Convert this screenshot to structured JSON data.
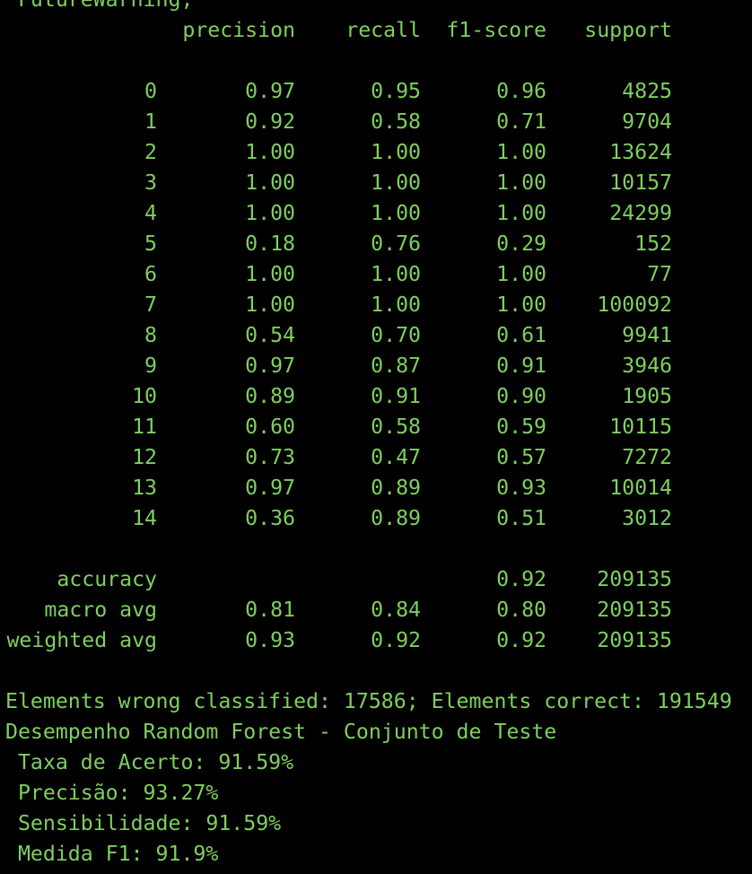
{
  "terminal": {
    "top_line": " FutureWarning,",
    "header": {
      "precision": "precision",
      "recall": "recall",
      "f1": "f1-score",
      "support": "support"
    },
    "rows": [
      {
        "label": "0",
        "precision": "0.97",
        "recall": "0.95",
        "f1": "0.96",
        "support": "4825"
      },
      {
        "label": "1",
        "precision": "0.92",
        "recall": "0.58",
        "f1": "0.71",
        "support": "9704"
      },
      {
        "label": "2",
        "precision": "1.00",
        "recall": "1.00",
        "f1": "1.00",
        "support": "13624"
      },
      {
        "label": "3",
        "precision": "1.00",
        "recall": "1.00",
        "f1": "1.00",
        "support": "10157"
      },
      {
        "label": "4",
        "precision": "1.00",
        "recall": "1.00",
        "f1": "1.00",
        "support": "24299"
      },
      {
        "label": "5",
        "precision": "0.18",
        "recall": "0.76",
        "f1": "0.29",
        "support": "152"
      },
      {
        "label": "6",
        "precision": "1.00",
        "recall": "1.00",
        "f1": "1.00",
        "support": "77"
      },
      {
        "label": "7",
        "precision": "1.00",
        "recall": "1.00",
        "f1": "1.00",
        "support": "100092"
      },
      {
        "label": "8",
        "precision": "0.54",
        "recall": "0.70",
        "f1": "0.61",
        "support": "9941"
      },
      {
        "label": "9",
        "precision": "0.97",
        "recall": "0.87",
        "f1": "0.91",
        "support": "3946"
      },
      {
        "label": "10",
        "precision": "0.89",
        "recall": "0.91",
        "f1": "0.90",
        "support": "1905"
      },
      {
        "label": "11",
        "precision": "0.60",
        "recall": "0.58",
        "f1": "0.59",
        "support": "10115"
      },
      {
        "label": "12",
        "precision": "0.73",
        "recall": "0.47",
        "f1": "0.57",
        "support": "7272"
      },
      {
        "label": "13",
        "precision": "0.97",
        "recall": "0.89",
        "f1": "0.93",
        "support": "10014"
      },
      {
        "label": "14",
        "precision": "0.36",
        "recall": "0.89",
        "f1": "0.51",
        "support": "3012"
      }
    ],
    "summary": [
      {
        "label": "accuracy",
        "precision": "",
        "recall": "",
        "f1": "0.92",
        "support": "209135"
      },
      {
        "label": "macro avg",
        "precision": "0.81",
        "recall": "0.84",
        "f1": "0.80",
        "support": "209135"
      },
      {
        "label": "weighted avg",
        "precision": "0.93",
        "recall": "0.92",
        "f1": "0.92",
        "support": "209135"
      }
    ],
    "footer_lines": [
      "Elements wrong classified: 17586; Elements correct: 191549",
      "Desempenho Random Forest - Conjunto de Teste",
      " Taxa de Acerto: 91.59%",
      " Precisão: 93.27%",
      " Sensibilidade: 91.59%",
      " Medida F1: 91.9%"
    ],
    "colors": {
      "background": "#000000",
      "text": "#7fcf5f"
    }
  }
}
